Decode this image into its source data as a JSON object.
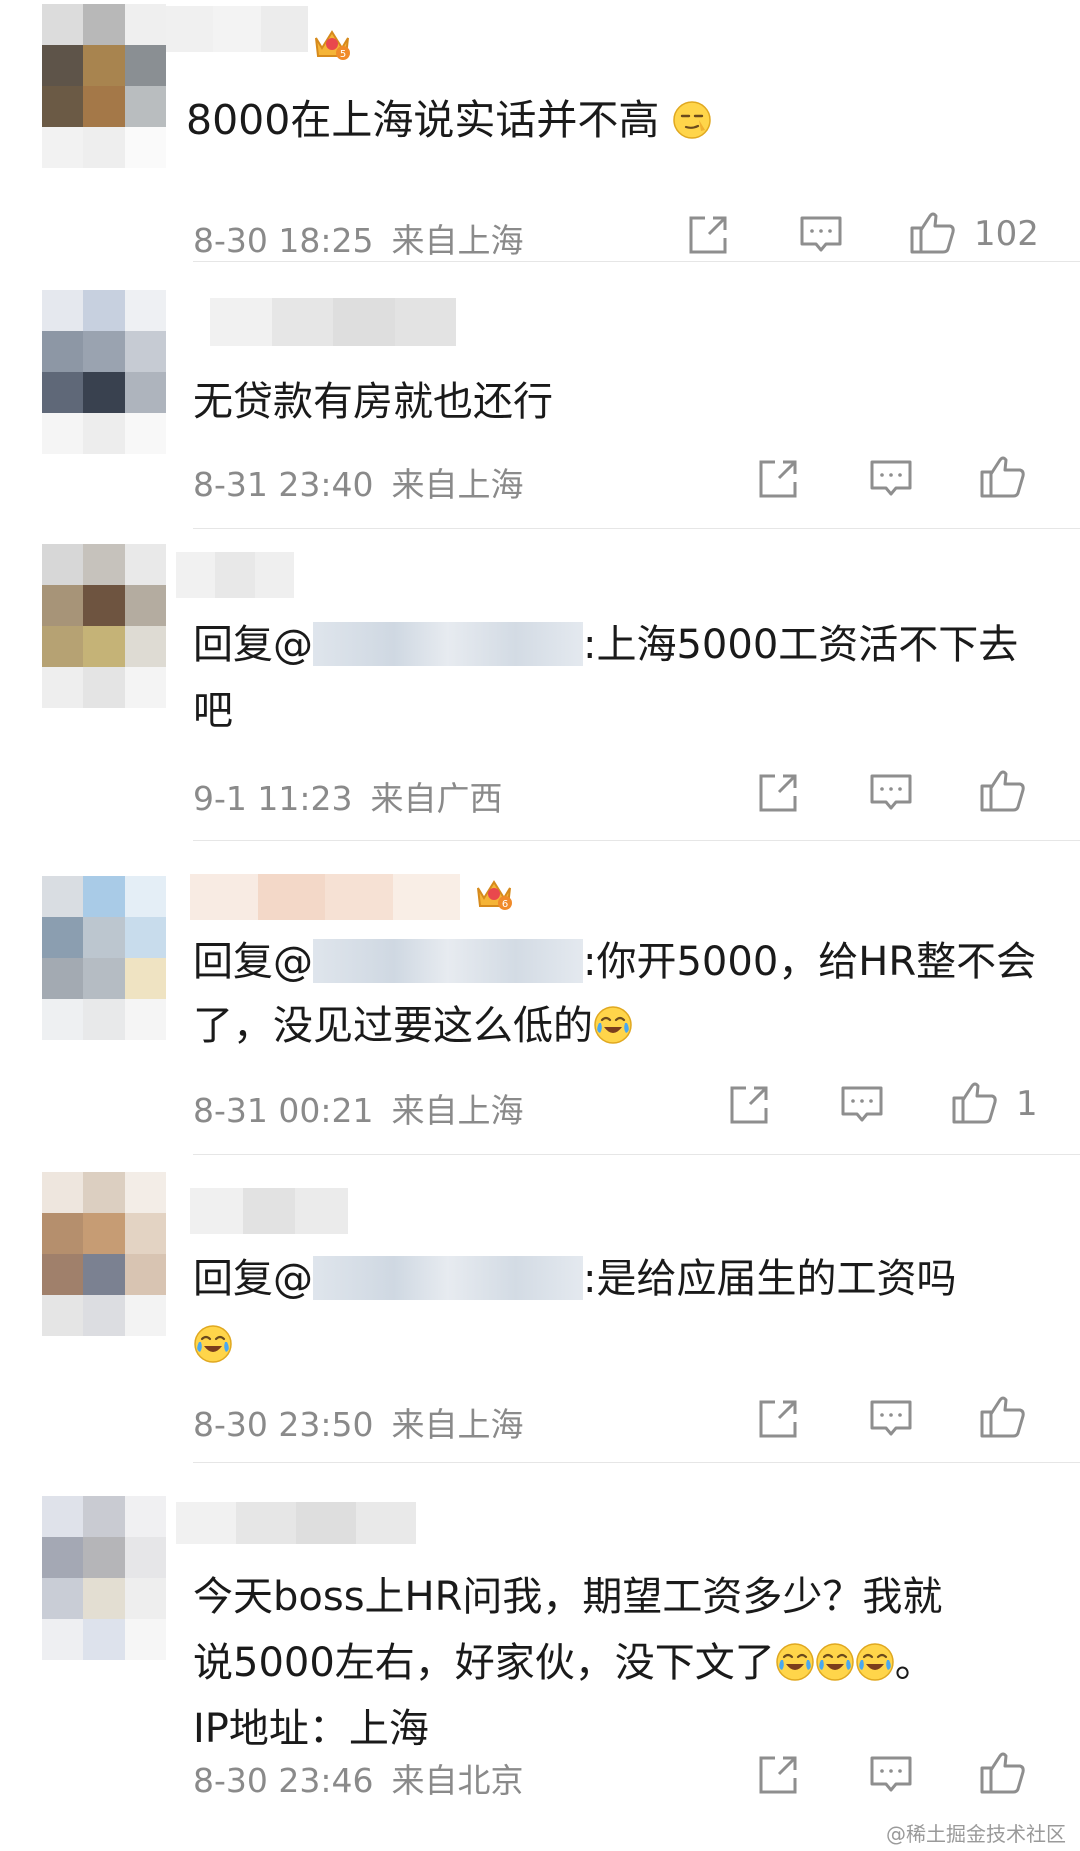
{
  "comments": [
    {
      "text": "8000在上海说实话并不高",
      "emoji": "smirk-emoji",
      "time": "8-30 18:25",
      "location": "来自上海",
      "likes": "102",
      "badge": "crown-badge-5"
    },
    {
      "text": "无贷款有房就也还行",
      "time": "8-31 23:40",
      "location": "来自上海",
      "likes": ""
    },
    {
      "reply_prefix": "回复@",
      "reply_text": ":上海5000工资活不下去吧",
      "time": "9-1 11:23",
      "location": "来自广西",
      "likes": ""
    },
    {
      "reply_prefix": "回复@",
      "reply_text": ":你开5000，给HR整不会了，没见过要这么低的",
      "emoji": "laugh-cry-emoji",
      "time": "8-31 00:21",
      "location": "来自上海",
      "likes": "1",
      "badge": "crown-badge-6"
    },
    {
      "reply_prefix": "回复@",
      "reply_text": ":是给应届生的工资吗",
      "emoji": "laugh-cry-emoji",
      "time": "8-30 23:50",
      "location": "来自上海",
      "likes": ""
    },
    {
      "text_line1": "今天boss上HR问我，期望工资多少？我就",
      "text_line2": "说5000左右，好家伙，没下文了",
      "text_line2_end": "。",
      "text_line3": "IP地址：上海",
      "emoji": "laugh-cry-emoji",
      "time": "8-30 23:46",
      "location": "来自北京",
      "likes": ""
    }
  ],
  "watermark": "@稀土掘金技术社区",
  "colors": {
    "text": "#1a1a1a",
    "meta": "#8a8a8a",
    "icon": "#8e8e8e",
    "divider": "#e6e6e6"
  },
  "icons": [
    "share-icon",
    "comment-icon",
    "like-icon"
  ]
}
